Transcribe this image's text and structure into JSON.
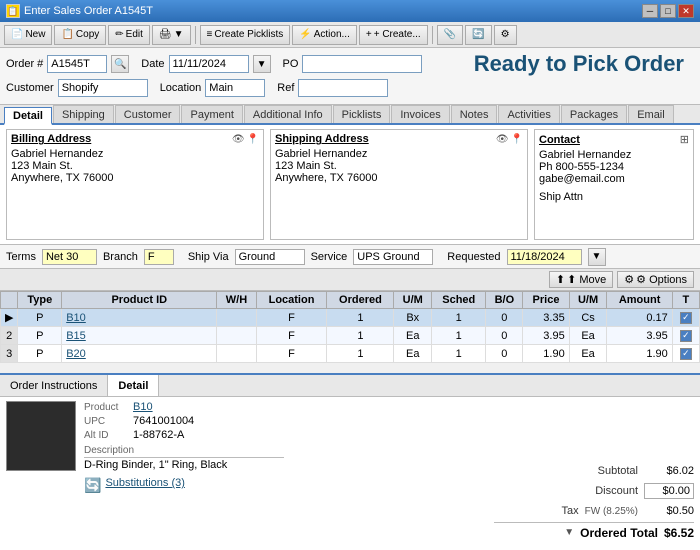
{
  "titlebar": {
    "title": "Enter Sales Order A1545T",
    "icon": "📋"
  },
  "toolbar": {
    "new_label": "New",
    "copy_label": "Copy",
    "edit_label": "Edit",
    "print_label": "▼",
    "create_picklists_label": "Create Picklists",
    "action_label": "Action...",
    "create_label": "+ Create...",
    "sep": "|"
  },
  "form": {
    "order_label": "Order #",
    "order_value": "A1545T",
    "date_label": "Date",
    "date_value": "11/11/2024",
    "po_label": "PO",
    "po_value": "",
    "customer_label": "Customer",
    "customer_value": "Shopify",
    "ref_label": "Ref",
    "ref_value": "",
    "location_label": "Location",
    "location_value": "Main",
    "ready_text": "Ready to Pick Order"
  },
  "tabs": [
    {
      "label": "Detail",
      "active": true
    },
    {
      "label": "Shipping",
      "active": false
    },
    {
      "label": "Customer",
      "active": false
    },
    {
      "label": "Payment",
      "active": false
    },
    {
      "label": "Additional Info",
      "active": false
    },
    {
      "label": "Picklists",
      "active": false
    },
    {
      "label": "Invoices",
      "active": false
    },
    {
      "label": "Notes",
      "active": false
    },
    {
      "label": "Activities",
      "active": false
    },
    {
      "label": "Packages",
      "active": false
    },
    {
      "label": "Email",
      "active": false
    }
  ],
  "billing": {
    "title": "Billing Address",
    "name": "Gabriel Hernandez",
    "street": "123 Main St.",
    "city_state": "Anywhere, TX 76000"
  },
  "shipping": {
    "title": "Shipping Address",
    "name": "Gabriel Hernandez",
    "street": "123 Main St.",
    "city_state": "Anywhere, TX 76000"
  },
  "contact": {
    "title": "Contact",
    "name": "Gabriel Hernandez",
    "phone": "Ph 800-555-1234",
    "email": "gabe@email.com",
    "ship_attn_label": "Ship Attn"
  },
  "terms": {
    "terms_label": "Terms",
    "terms_value": "Net 30",
    "branch_label": "Branch",
    "branch_value": "F",
    "shipvia_label": "Ship Via",
    "shipvia_value": "Ground",
    "service_label": "Service",
    "service_value": "UPS Ground",
    "requested_label": "Requested",
    "requested_value": "11/18/2024"
  },
  "actions": {
    "move_label": "⬆ Move",
    "options_label": "⚙ Options"
  },
  "table": {
    "headers": [
      "",
      "Type",
      "Product ID",
      "W/H",
      "Location",
      "Ordered",
      "U/M",
      "Sched",
      "B/O",
      "Price",
      "U/M",
      "Amount",
      "T"
    ],
    "rows": [
      {
        "selector": "▶",
        "type": "P",
        "product_id": "B10",
        "wh": "",
        "location": "F",
        "ordered": "1",
        "um": "Bx",
        "sched": "1",
        "bo": "0",
        "price": "3.35",
        "um2": "Cs",
        "amount": "0.17",
        "t": true,
        "selected": true
      },
      {
        "selector": "2",
        "type": "P",
        "product_id": "B15",
        "wh": "",
        "location": "F",
        "ordered": "1",
        "um": "Ea",
        "sched": "1",
        "bo": "0",
        "price": "3.95",
        "um2": "Ea",
        "amount": "3.95",
        "t": true,
        "selected": false
      },
      {
        "selector": "3",
        "type": "P",
        "product_id": "B20",
        "wh": "",
        "location": "F",
        "ordered": "1",
        "um": "Ea",
        "sched": "1",
        "bo": "0",
        "price": "1.90",
        "um2": "Ea",
        "amount": "1.90",
        "t": true,
        "selected": false
      }
    ]
  },
  "bottom_tabs": [
    {
      "label": "Order Instructions",
      "active": false
    },
    {
      "label": "Detail",
      "active": true
    }
  ],
  "product_detail": {
    "product_label": "Product",
    "product_value": "B10",
    "upc_label": "UPC",
    "upc_value": "7641001004",
    "altid_label": "Alt ID",
    "altid_value": "1-88762-A",
    "description_label": "Description",
    "description_value": "D-Ring Binder, 1\" Ring, Black",
    "substitutions_label": "Substitutions (3)"
  },
  "totals": {
    "subtotal_label": "Subtotal",
    "subtotal_value": "$6.02",
    "discount_label": "Discount",
    "discount_value": "$0.00",
    "tax_label": "Tax",
    "tax_bracket": "FW (8.25%)",
    "tax_value": "$0.50",
    "ordered_total_label": "Ordered Total",
    "ordered_total_value": "$6.52"
  }
}
